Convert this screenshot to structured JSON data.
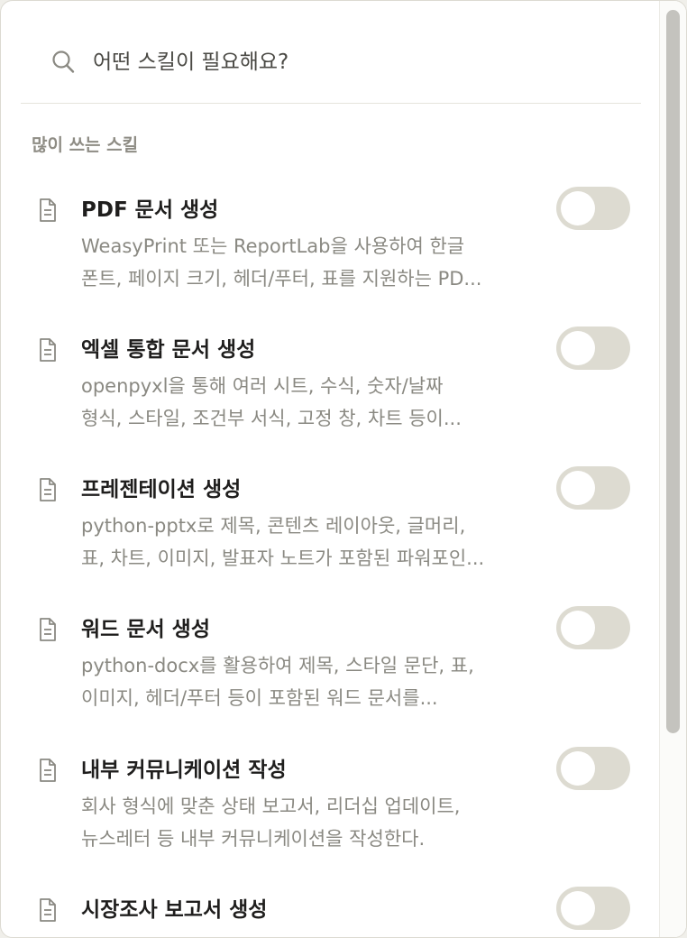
{
  "search": {
    "placeholder": "어떤 스킬이 필요해요?"
  },
  "section": {
    "header": "많이 쓰는 스킬"
  },
  "skills": [
    {
      "title": "PDF 문서 생성",
      "desc_line1": "WeasyPrint 또는 ReportLab을 사용하여 한글",
      "desc_line2": "폰트, 페이지 크기, 헤더/푸터, 표를 지원하는 PD...",
      "enabled": false
    },
    {
      "title": "엑셀 통합 문서 생성",
      "desc_line1": "openpyxl을 통해 여러 시트, 수식, 숫자/날짜",
      "desc_line2": "형식, 스타일, 조건부 서식, 고정 창, 차트 등이...",
      "enabled": false
    },
    {
      "title": "프레젠테이션 생성",
      "desc_line1": "python-pptx로 제목, 콘텐츠 레이아웃, 글머리,",
      "desc_line2": "표, 차트, 이미지, 발표자 노트가 포함된 파워포인...",
      "enabled": false
    },
    {
      "title": "워드 문서 생성",
      "desc_line1": "python-docx를 활용하여 제목, 스타일 문단, 표,",
      "desc_line2": "이미지, 헤더/푸터 등이 포함된 워드 문서를...",
      "enabled": false
    },
    {
      "title": "내부 커뮤니케이션 작성",
      "desc_line1": "회사 형식에 맞춘 상태 보고서, 리더십 업데이트,",
      "desc_line2": "뉴스레터 등 내부 커뮤니케이션을 작성한다.",
      "enabled": false
    },
    {
      "title": "시장조사 보고서 생성",
      "desc_line1": "",
      "desc_line2": "",
      "enabled": false
    }
  ],
  "icons": {
    "search": "search-icon",
    "document": "document-icon"
  },
  "colors": {
    "toggle_off": "#dddbd1",
    "title": "#1f1e1d",
    "description": "#8a8982",
    "section_header": "#8e8c84"
  }
}
